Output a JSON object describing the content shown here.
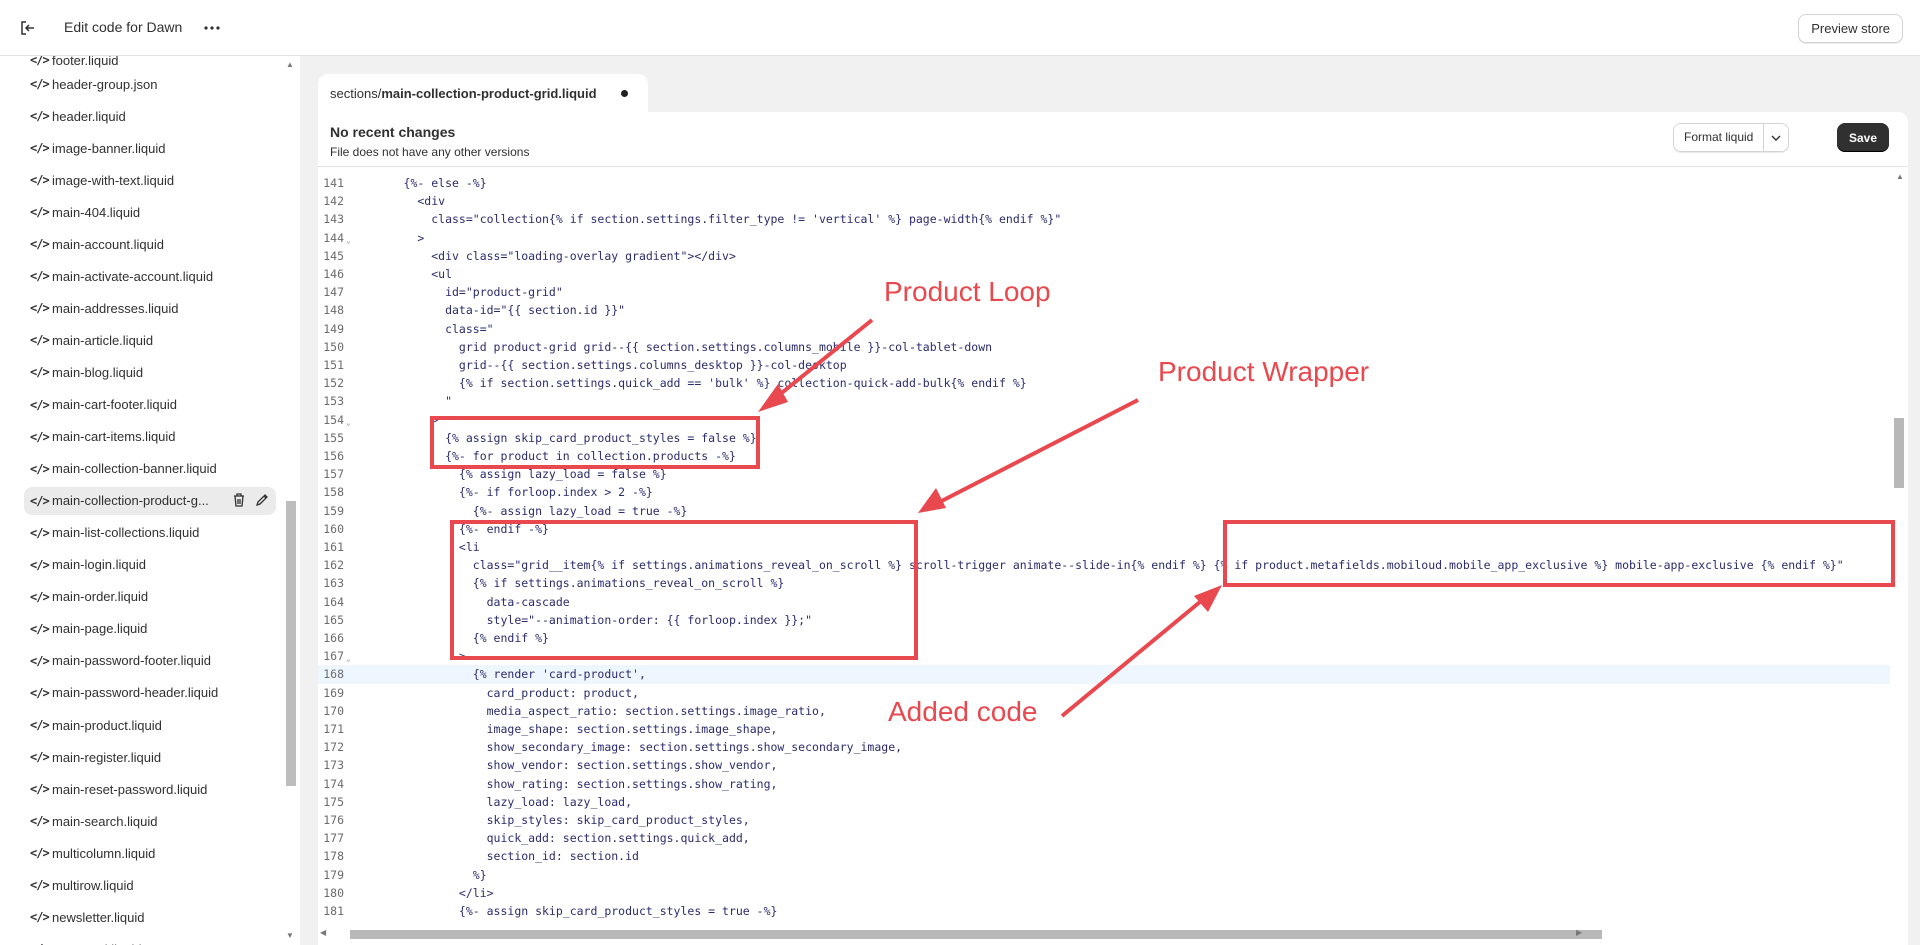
{
  "topbar": {
    "title": "Edit code for Dawn",
    "preview_label": "Preview store",
    "exit_icon": "exit-icon",
    "more_icon": "more-horizontal-icon"
  },
  "sidebar": {
    "partial_top": "footer.liquid",
    "partial_bottom": "password.liquid",
    "items": [
      "header-group.json",
      "header.liquid",
      "image-banner.liquid",
      "image-with-text.liquid",
      "main-404.liquid",
      "main-account.liquid",
      "main-activate-account.liquid",
      "main-addresses.liquid",
      "main-article.liquid",
      "main-blog.liquid",
      "main-cart-footer.liquid",
      "main-cart-items.liquid",
      "main-collection-banner.liquid",
      "main-collection-product-g...",
      "main-list-collections.liquid",
      "main-login.liquid",
      "main-order.liquid",
      "main-page.liquid",
      "main-password-footer.liquid",
      "main-password-header.liquid",
      "main-product.liquid",
      "main-register.liquid",
      "main-reset-password.liquid",
      "main-search.liquid",
      "multicolumn.liquid",
      "multirow.liquid",
      "newsletter.liquid"
    ],
    "active_index": 13
  },
  "tab": {
    "dir": "sections/",
    "name": "main-collection-product-grid.liquid",
    "unsaved": true
  },
  "changes": {
    "title": "No recent changes",
    "subtitle": "File does not have any other versions"
  },
  "buttons": {
    "format": "Format liquid",
    "save": "Save"
  },
  "code": {
    "current_line": 168,
    "lines": [
      {
        "n": 141,
        "t": "      {%- else -%}"
      },
      {
        "n": 142,
        "t": "        <div"
      },
      {
        "n": 143,
        "t": "          class=\"collection{% if section.settings.filter_type != 'vertical' %} page-width{% endif %}\""
      },
      {
        "n": 144,
        "t": "        >",
        "fold": true
      },
      {
        "n": 145,
        "t": "          <div class=\"loading-overlay gradient\"></div>"
      },
      {
        "n": 146,
        "t": "          <ul"
      },
      {
        "n": 147,
        "t": "            id=\"product-grid\""
      },
      {
        "n": 148,
        "t": "            data-id=\"{{ section.id }}\""
      },
      {
        "n": 149,
        "t": "            class=\""
      },
      {
        "n": 150,
        "t": "              grid product-grid grid--{{ section.settings.columns_mobile }}-col-tablet-down"
      },
      {
        "n": 151,
        "t": "              grid--{{ section.settings.columns_desktop }}-col-desktop"
      },
      {
        "n": 152,
        "t": "              {% if section.settings.quick_add == 'bulk' %} collection-quick-add-bulk{% endif %}"
      },
      {
        "n": 153,
        "t": "            \""
      },
      {
        "n": 154,
        "t": "          >",
        "fold": true
      },
      {
        "n": 155,
        "t": "            {% assign skip_card_product_styles = false %}"
      },
      {
        "n": 156,
        "t": "            {%- for product in collection.products -%}"
      },
      {
        "n": 157,
        "t": "              {% assign lazy_load = false %}"
      },
      {
        "n": 158,
        "t": "              {%- if forloop.index > 2 -%}"
      },
      {
        "n": 159,
        "t": "                {%- assign lazy_load = true -%}"
      },
      {
        "n": 160,
        "t": "              {%- endif -%}"
      },
      {
        "n": 161,
        "t": "              <li"
      },
      {
        "n": 162,
        "t": "                class=\"grid__item{% if settings.animations_reveal_on_scroll %} scroll-trigger animate--slide-in{% endif %} {% if product.metafields.mobiloud.mobile_app_exclusive %} mobile-app-exclusive {% endif %}\""
      },
      {
        "n": 163,
        "t": "                {% if settings.animations_reveal_on_scroll %}"
      },
      {
        "n": 164,
        "t": "                  data-cascade"
      },
      {
        "n": 165,
        "t": "                  style=\"--animation-order: {{ forloop.index }};\""
      },
      {
        "n": 166,
        "t": "                {% endif %}"
      },
      {
        "n": 167,
        "t": "              >",
        "fold": true
      },
      {
        "n": 168,
        "t": "                {% render 'card-product',"
      },
      {
        "n": 169,
        "t": "                  card_product: product,"
      },
      {
        "n": 170,
        "t": "                  media_aspect_ratio: section.settings.image_ratio,"
      },
      {
        "n": 171,
        "t": "                  image_shape: section.settings.image_shape,"
      },
      {
        "n": 172,
        "t": "                  show_secondary_image: section.settings.show_secondary_image,"
      },
      {
        "n": 173,
        "t": "                  show_vendor: section.settings.show_vendor,"
      },
      {
        "n": 174,
        "t": "                  show_rating: section.settings.show_rating,"
      },
      {
        "n": 175,
        "t": "                  lazy_load: lazy_load,"
      },
      {
        "n": 176,
        "t": "                  skip_styles: skip_card_product_styles,"
      },
      {
        "n": 177,
        "t": "                  quick_add: section.settings.quick_add,"
      },
      {
        "n": 178,
        "t": "                  section_id: section.id"
      },
      {
        "n": 179,
        "t": "                %}"
      },
      {
        "n": 180,
        "t": "              </li>"
      },
      {
        "n": 181,
        "t": "              {%- assign skip_card_product_styles = true -%}"
      }
    ]
  },
  "annotations": {
    "color": "#e8484e",
    "labels": [
      "Product Loop",
      "Product Wrapper",
      "Added code"
    ]
  }
}
